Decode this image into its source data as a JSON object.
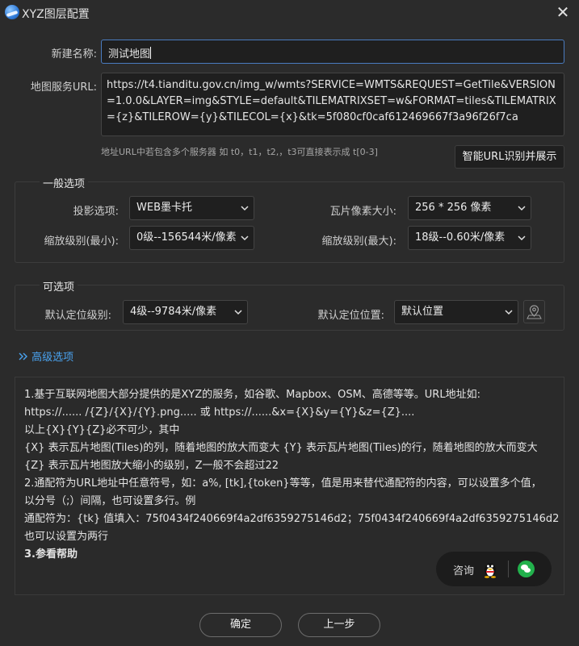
{
  "window": {
    "title": "XYZ图层配置",
    "close_glyph": "✕"
  },
  "form": {
    "name_label": "新建名称:",
    "name_value": "测试地图",
    "url_label": "地图服务URL:",
    "url_value": "https://t4.tianditu.gov.cn/img_w/wmts?SERVICE=WMTS&REQUEST=GetTile&VERSION=1.0.0&LAYER=img&STYLE=default&TILEMATRIXSET=w&FORMAT=tiles&TILEMATRIX={z}&TILEROW={y}&TILECOL={x}&tk=5f080cf0caf612469667f3a96f26f7ca",
    "hint": "地址URL中若包含多个服务器 如 t0，t1，t2,，t3可直接表示成 t[0-3]",
    "smart_button": "智能URL识别并展示"
  },
  "general": {
    "title": "一般选项",
    "projection_label": "投影选项:",
    "projection_value": "WEB墨卡托",
    "tile_size_label": "瓦片像素大小:",
    "tile_size_value": "256 * 256 像素",
    "zoom_min_label": "缩放级别(最小):",
    "zoom_min_value": "0级--156544米/像素",
    "zoom_max_label": "缩放级别(最大):",
    "zoom_max_value": "18级--0.60米/像素"
  },
  "optional": {
    "title": "可选项",
    "default_level_label": "默认定位级别:",
    "default_level_value": "4级--9784米/像素",
    "default_pos_label": "默认定位位置:",
    "default_pos_value": "默认位置"
  },
  "advanced": {
    "label": "高级选项",
    "icon": "double-chevron-right-icon"
  },
  "help": {
    "lines": [
      "1.基于互联网地图大部分提供的是XYZ的服务，如谷歌、Mapbox、OSM、高德等等。URL地址如:",
      "https://...... /{Z}/{X}/{Y}.png.....      或     https://......&x={X}&y={Y}&z={Z}....",
      "以上{X}{Y}{Z}必不可少，其中",
      "{X}    表示瓦片地图(Tiles)的列，随着地图的放大而变大          {Y}    表示瓦片地图(Tiles)的行，随着地图的放大而变大",
      "{Z}    表示瓦片地图放大缩小的级别，Z一般不会超过22",
      "2.通配符为URL地址中任意符号，如：a%, [tk],{token}等等，值是用来替代通配符的内容，可以设置多个值，",
      "以分号（;）间隔，也可设置多行。例",
      "通配符为：{tk} 值填入：75f0434f240669f4a2df6359275146d2；75f0434f240669f4a2df6359275146d2",
      "也可以设置为两行",
      "3.参看帮助"
    ]
  },
  "consult": {
    "label": "咨询"
  },
  "buttons": {
    "ok": "确定",
    "prev": "上一步"
  },
  "colors": {
    "accent": "#4aa3f0",
    "background": "#2b2b2b",
    "input_bg": "#1f1f1f"
  }
}
